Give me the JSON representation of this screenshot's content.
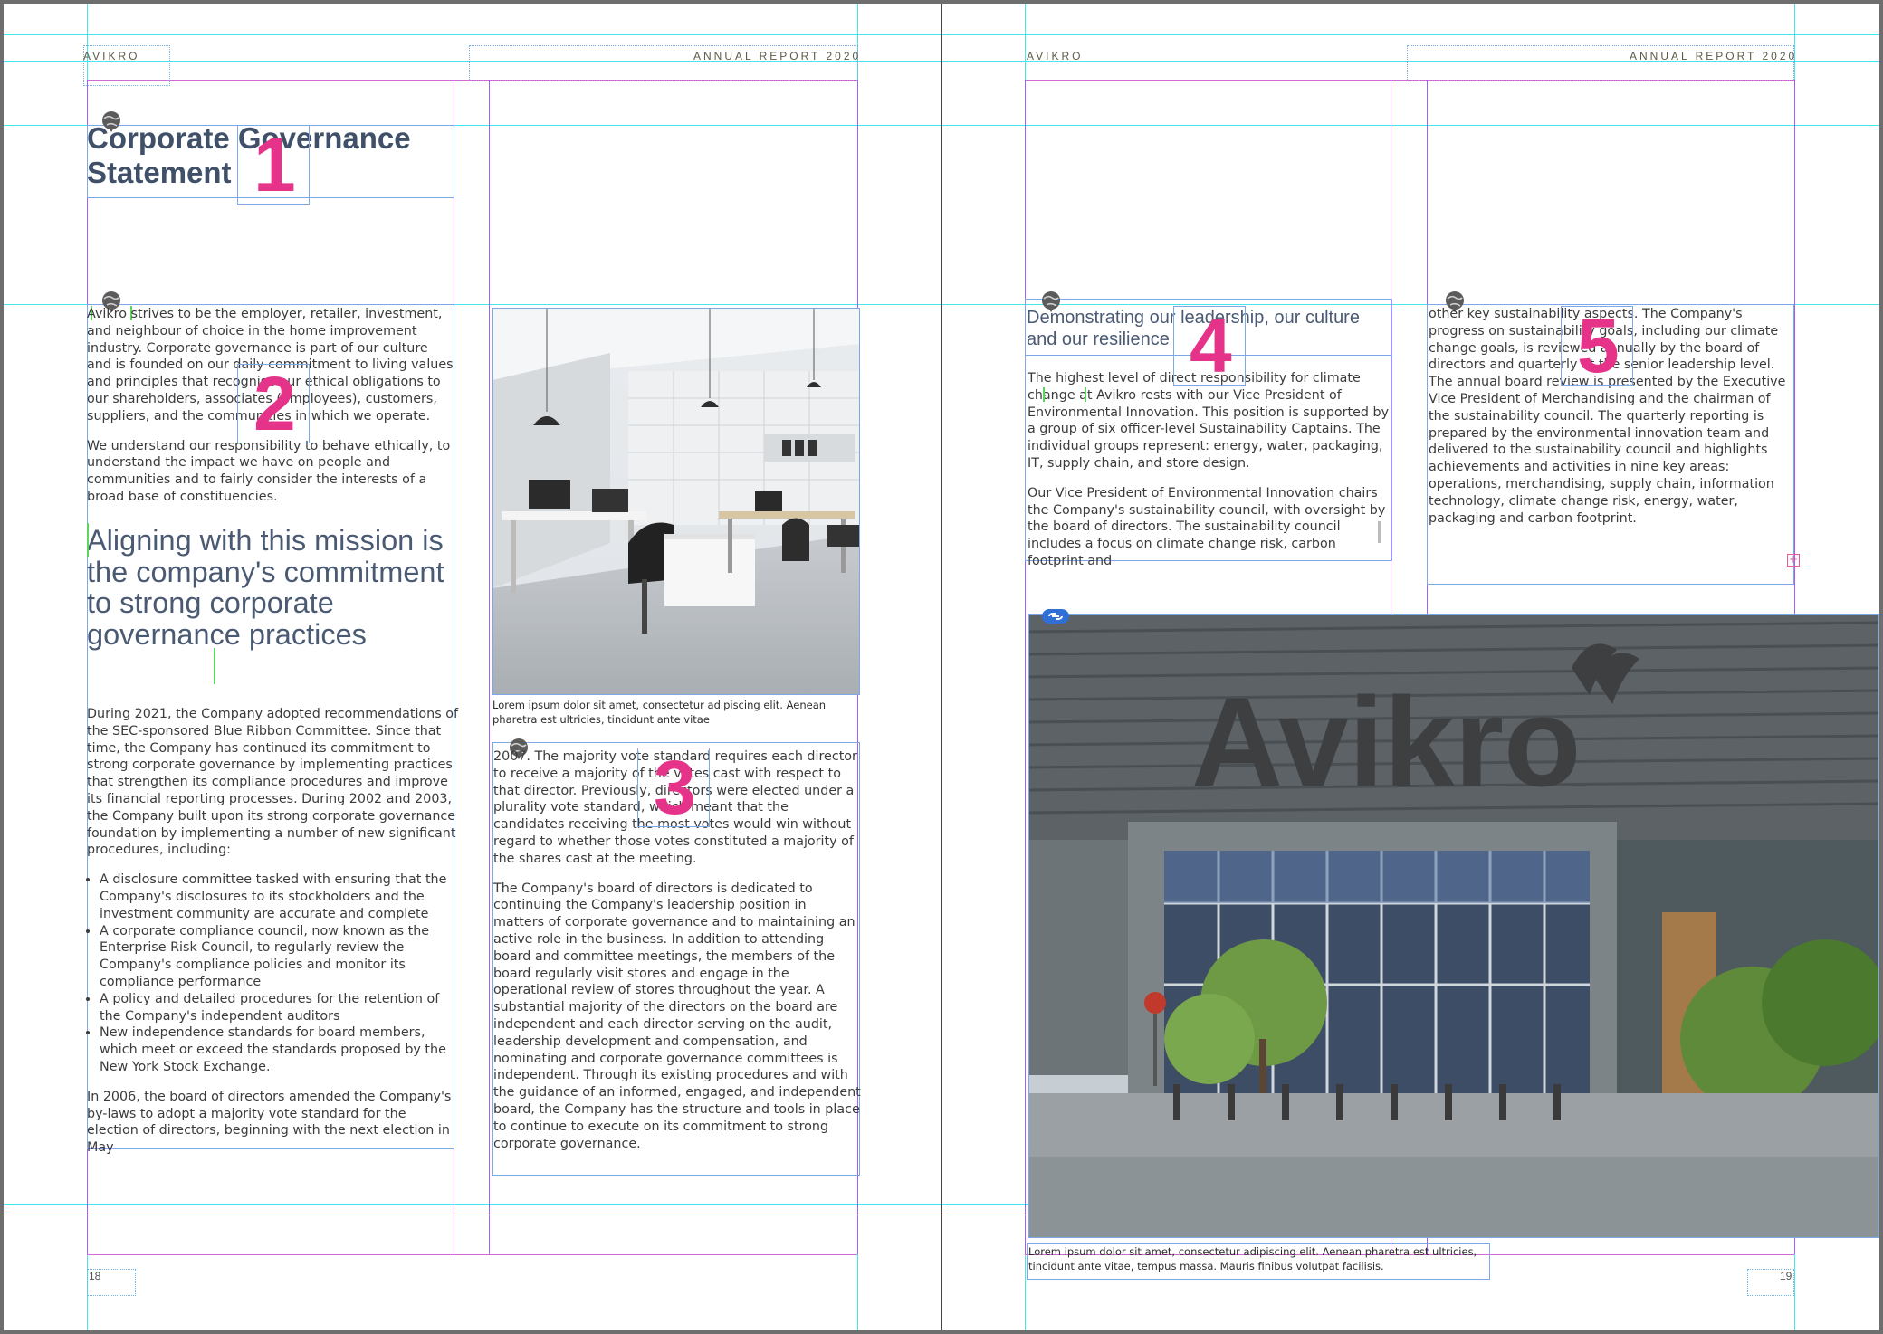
{
  "running_header": {
    "left": "AVIKRO",
    "right": "ANNUAL REPORT 2020"
  },
  "left_page": {
    "title": "Corporate Governance Statement",
    "intro_paragraphs": [
      "Avikro strives to be the employer, retailer, investment, and neighbour of choice in the home improvement industry. Corporate governance is part of our culture and is founded on our daily commitment to living values and principles that recognise our ethical obligations to our shareholders, associates (employees), customers, suppliers, and the communities in which we operate.",
      "We understand our responsibility to behave ethically, to understand the impact we have on people and communities and to fairly consider the interests of a broad base of constituencies."
    ],
    "pull_quote": "Aligning with this mission is the company's commitment to strong corporate governance practices",
    "history_paragraph": "During 2021, the Company adopted recommendations of the SEC-sponsored Blue Ribbon Committee. Since that time, the Company has continued its commitment to strong corporate governance by implementing practices that strengthen its compliance procedures and improve its financial reporting processes. During 2002 and 2003, the Company built upon its strong corporate governance foundation by implementing a number of new significant procedures, including:",
    "bullets": [
      "A disclosure committee tasked with ensuring that the Company's disclosures to its stockholders and the investment community are accurate and complete",
      "A corporate compliance council, now known as the Enterprise Risk Council, to regularly review the Company's compliance policies and monitor its compliance performance",
      "A policy and detailed procedures for the retention of the Company's independent auditors",
      "New independence standards for board members, which meet or exceed the standards proposed by the New York Stock Exchange."
    ],
    "closing_paragraph": "In 2006, the board of directors amended the Company's by-laws to adopt a majority vote standard for the election of directors, beginning with the next election in May",
    "image_caption": "Lorem ipsum dolor sit amet, consectetur adipiscing elit. Aenean pharetra est ultricies, tincidunt ante vitae",
    "col2_paragraphs": [
      "2007. The majority vote standard requires each director to receive a majority of the votes cast with respect to that director. Previously, directors were elected under a plurality vote standard, which meant that the candidates receiving the most votes would win without regard to whether those votes constituted a majority of the shares cast at the meeting.",
      "The Company's board of directors is dedicated to continuing the Company's leadership position in matters of corporate governance and to maintaining an active role in the business. In addition to attending board and committee meetings, the members of the board regularly visit stores and engage in the operational review of stores throughout the year. A substantial majority of the directors on the board are independent and each director serving on the audit, leadership development and compensation, and nominating and corporate governance committees is independent. Through its existing procedures and with the guidance of an informed, engaged, and independent board, the Company has the structure and tools in place to continue to execute on its commitment to strong corporate governance."
    ],
    "page_number": "18"
  },
  "right_page": {
    "subheading": "Demonstrating our leadership, our culture and our resilience",
    "col1_paragraphs": [
      "The highest level of direct responsibility for climate change at Avikro rests with our Vice President of Environmental Innovation. This position is supported by a group of six officer-level Sustainability Captains. The individual groups represent: energy, water, packaging, IT, supply chain, and store design.",
      "Our Vice President of Environmental Innovation chairs the Company's sustainability council, with oversight by the board of directors. The sustainability council includes a focus on climate change risk, carbon footprint and"
    ],
    "col2_paragraph": "other key sustainability aspects. The Company's progress on sustainability goals, including our climate change goals, is reviewed annually by the board of directors and quarterly at the senior leadership level. The annual board review is presented by the Executive Vice President of Merchandising and the chairman of the sustainability council. The quarterly reporting is prepared by the environmental innovation team and delivered to the sustainability council and highlights achievements and activities in nine key areas: operations, merchandising, supply chain, information technology, climate change risk, energy, water, packaging and carbon footprint.",
    "storefront_sign": "Avikro",
    "image_caption": "Lorem ipsum dolor sit amet, consectetur adipiscing elit. Aenean pharetra est ultricies, tincidunt ante vitae, tempus massa. Mauris finibus volutpat facilisis.",
    "page_number": "19"
  },
  "frame_numbers": [
    "1",
    "2",
    "3",
    "4",
    "5"
  ],
  "colors": {
    "heading": "#3f5068",
    "guide_cyan": "#28e1e8",
    "guide_purple": "#a35ef5",
    "frame_blue": "#7ea7e8",
    "frame_number_pink": "#e6338a"
  },
  "icons": [
    "globe-story-icon",
    "link-icon",
    "overset-plus-icon"
  ]
}
